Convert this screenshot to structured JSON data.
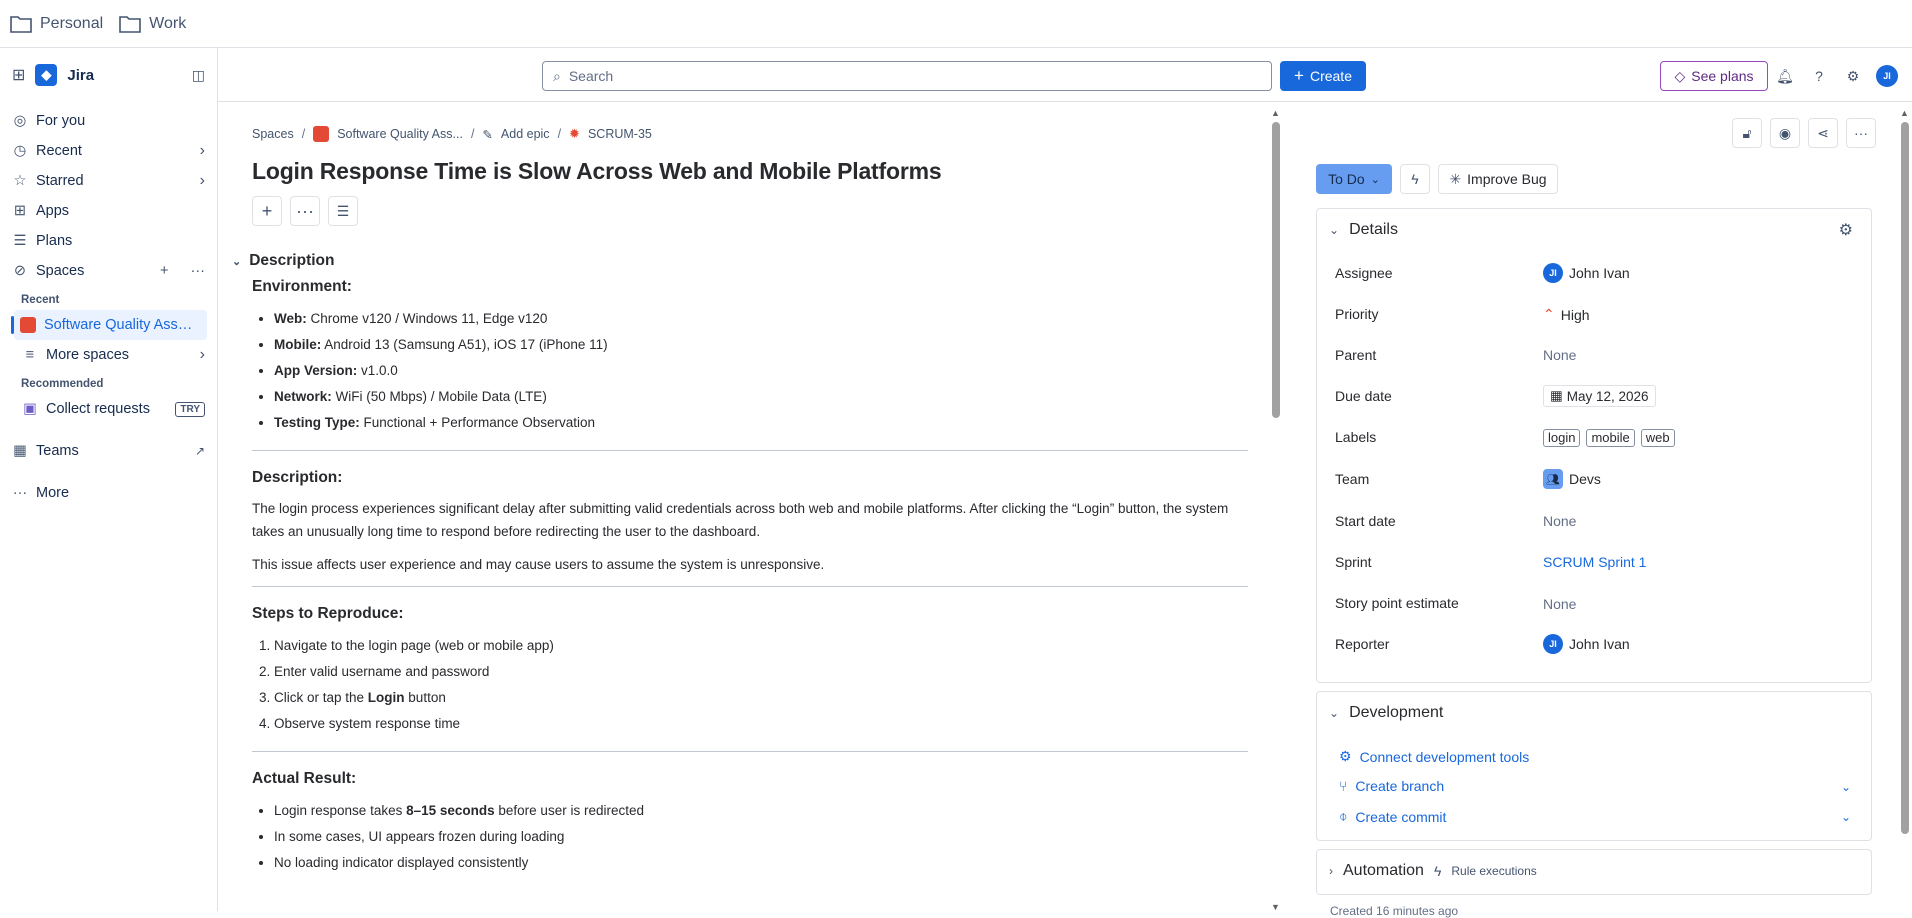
{
  "bookmarks": [
    {
      "label": "Personal"
    },
    {
      "label": "Work"
    }
  ],
  "sidebar": {
    "app_name": "Jira",
    "items": [
      {
        "label": "For you"
      },
      {
        "label": "Recent"
      },
      {
        "label": "Starred"
      },
      {
        "label": "Apps"
      },
      {
        "label": "Plans"
      },
      {
        "label": "Spaces"
      }
    ],
    "recent_heading": "Recent",
    "recent_space": "Software Quality Assur...",
    "more_spaces": "More spaces",
    "recommended_heading": "Recommended",
    "collect_requests": "Collect requests",
    "try_badge": "TRY",
    "teams": "Teams",
    "more": "More"
  },
  "topbar": {
    "search_placeholder": "Search",
    "create_label": "Create",
    "see_plans_label": "See plans",
    "avatar_initials": "JI"
  },
  "issue": {
    "breadcrumb": {
      "spaces": "Spaces",
      "project": "Software Quality Ass...",
      "add_epic": "Add epic",
      "key": "SCRUM-35"
    },
    "title": "Login Response Time is Slow Across Web and Mobile Platforms",
    "description_heading": "Description",
    "environment_heading": "Environment:",
    "environment": [
      {
        "k": "Web:",
        "v": " Chrome v120 / Windows 11, Edge v120"
      },
      {
        "k": "Mobile:",
        "v": " Android 13 (Samsung A51), iOS 17 (iPhone 11)"
      },
      {
        "k": "App Version:",
        "v": " v1.0.0"
      },
      {
        "k": "Network:",
        "v": " WiFi (50 Mbps) / Mobile Data (LTE)"
      },
      {
        "k": "Testing Type:",
        "v": " Functional + Performance Observation"
      }
    ],
    "desc_heading": "Description:",
    "desc_p1": "The login process experiences significant delay after submitting valid credentials across both web and mobile platforms. After clicking the “Login” button, the system takes an unusually long time to respond before redirecting the user to the dashboard.",
    "desc_p2": "This issue affects user experience and may cause users to assume the system is unresponsive.",
    "steps_heading": "Steps to Reproduce:",
    "steps": {
      "s1": "Navigate to the login page (web or mobile app)",
      "s2": "Enter valid username and password",
      "s3_pre": "Click or tap the ",
      "s3_bold": "Login",
      "s3_post": " button",
      "s4": "Observe system response time"
    },
    "actual_heading": "Actual Result:",
    "actual": {
      "a1_pre": "Login response takes ",
      "a1_bold": "8–15 seconds",
      "a1_post": " before user is redirected",
      "a2": "In some cases, UI appears frozen during loading",
      "a3": "No loading indicator displayed consistently"
    }
  },
  "right": {
    "status": "To Do",
    "improve_label": "Improve Bug",
    "details_heading": "Details",
    "fields": {
      "assignee_label": "Assignee",
      "assignee": "John Ivan",
      "assignee_initials": "JI",
      "priority_label": "Priority",
      "priority": "High",
      "parent_label": "Parent",
      "parent": "None",
      "due_label": "Due date",
      "due": "May 12, 2026",
      "labels_label": "Labels",
      "labels": [
        "login",
        "mobile",
        "web"
      ],
      "team_label": "Team",
      "team": "Devs",
      "start_label": "Start date",
      "start": "None",
      "sprint_label": "Sprint",
      "sprint": "SCRUM Sprint 1",
      "story_label": "Story point estimate",
      "story": "None",
      "reporter_label": "Reporter",
      "reporter": "John Ivan",
      "reporter_initials": "JI"
    },
    "development_heading": "Development",
    "dev_items": [
      "Connect development tools",
      "Create branch",
      "Create commit"
    ],
    "automation_heading": "Automation",
    "rule_executions": "Rule executions",
    "created": "Created 16 minutes ago"
  },
  "colors": {
    "accent": "#1868db",
    "status": "#669df1",
    "bug": "#e34935",
    "see_plans": "#964ac0"
  }
}
